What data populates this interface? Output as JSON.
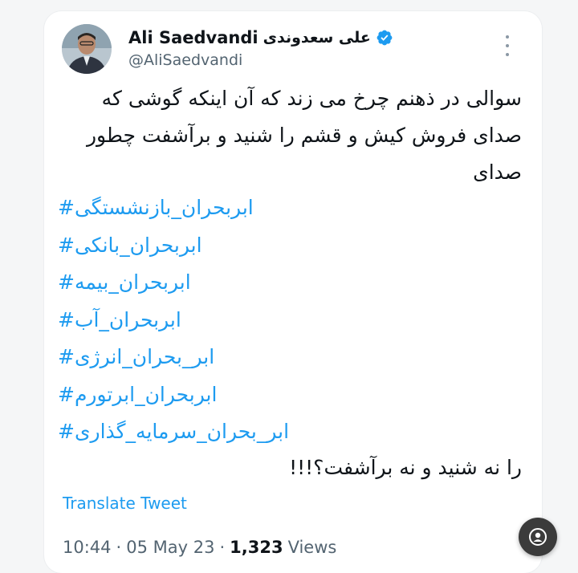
{
  "tweet": {
    "display_name_en": "Ali Saedvandi",
    "display_name_fa": "علی سعدوندی",
    "handle": "@AliSaedvandi",
    "body": "سوالی در ذهنم چرخ می زند که آن اینکه گوشی که صدای فروش کیش و قشم را شنید و برآشفت چطور صدای",
    "hashtags": [
      "ابربحران_بازنشستگی#",
      "ابربحران_بانکی#",
      "ابربحران_بیمه#",
      "ابربحران_آب#",
      "ابر_بحران_انرژی#",
      "ابربحران_ابرتورم#",
      "ابر_بحران_سرمایه_گذاری#"
    ],
    "tail": "را نه شنید و نه برآشفت؟!!!",
    "translate_label": "Translate Tweet",
    "time": "10:44",
    "date": "05 May 23",
    "views_count": "1,323",
    "views_label": "Views",
    "separator": "·"
  },
  "icons": {
    "verified": "verified-badge-icon",
    "more": "more-options-icon",
    "fab": "user-icon"
  },
  "colors": {
    "link": "#1d9bf0",
    "text": "#0f1419",
    "muted": "#536471",
    "verified": "#1d9bf0"
  }
}
